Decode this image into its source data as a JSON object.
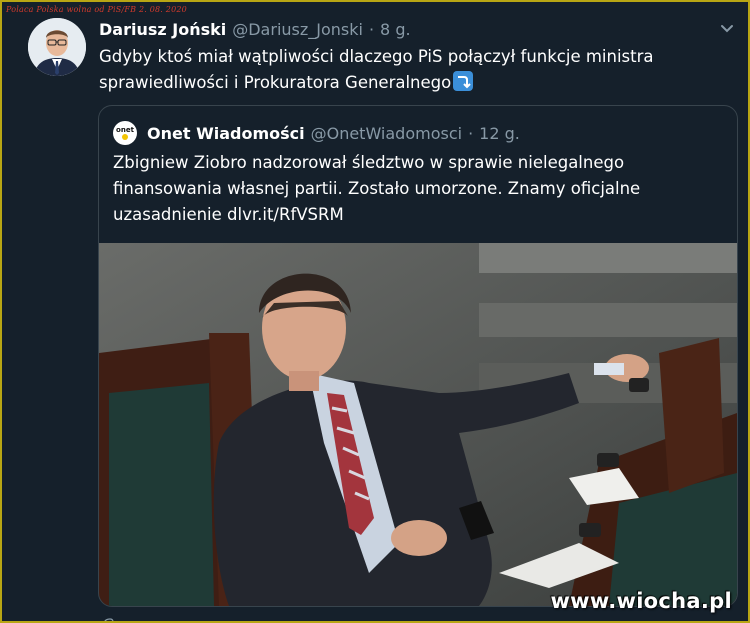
{
  "watermark_top": "Polaca  Polska wolna od PiS/FB 2. 08. 2020",
  "tweet": {
    "author_name": "Dariusz Joński",
    "author_handle": "@Dariusz_Jonski",
    "separator": "·",
    "time": "8 g.",
    "text": "Gdyby ktoś miał wątpliwości dlaczego PiS połączył funkcje ministra sprawiedliwości i Prokuratora Generalnego",
    "caret_icon": "chevron-down-icon",
    "emoji_icon": "arrow-right-hook-down-icon"
  },
  "quote": {
    "logo_text": "onet",
    "author_name": "Onet Wiadomości",
    "author_handle": "@OnetWiadomosci",
    "separator": "·",
    "time": "12 g.",
    "text": "Zbigniew Ziobro nadzorował śledztwo w sprawie nielegalnego finansowania własnej partii. Zostało umorzone. Znamy oficjalne uzasadnienie dlvr.it/RfVSRM"
  },
  "site_watermark": "www.wiocha.pl",
  "colors": {
    "background": "#15202b",
    "border_gold": "#b8a614",
    "muted": "#8899a6",
    "text": "#ffffff",
    "accent": "#1da1f2"
  }
}
